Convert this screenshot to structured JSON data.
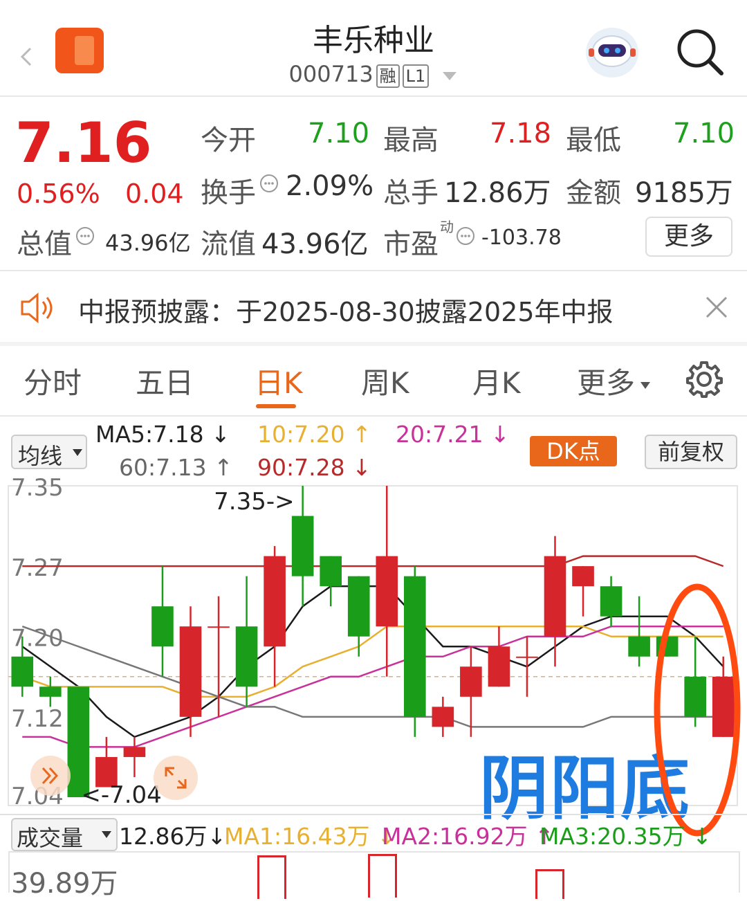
{
  "header": {
    "stock_name": "丰乐种业",
    "stock_code": "000713",
    "tag_margin": "融",
    "tag_level": "L1"
  },
  "quote": {
    "price": "7.16",
    "change_pct": "0.56%",
    "change_amt": "0.04",
    "open_label": "今开",
    "open_value": "7.10",
    "high_label": "最高",
    "high_value": "7.18",
    "low_label": "最低",
    "low_value": "7.10",
    "turnover_label": "换手",
    "turnover_value": "2.09%",
    "volume_label": "总手",
    "volume_value": "12.86万",
    "amount_label": "金额",
    "amount_value": "9185万",
    "mcap_label": "总值",
    "mcap_value": "43.96亿",
    "float_label": "流值",
    "float_value": "43.96亿",
    "pe_label": "市盈",
    "pe_super": "动",
    "pe_value": "-103.78",
    "more_button": "更多"
  },
  "notice": {
    "text": "中报预披露：于2025-08-30披露2025年中报"
  },
  "tabs": [
    {
      "label": "分时",
      "active": false
    },
    {
      "label": "五日",
      "active": false
    },
    {
      "label": "日K",
      "active": true
    },
    {
      "label": "周K",
      "active": false
    },
    {
      "label": "月K",
      "active": false
    },
    {
      "label": "更多",
      "active": false
    }
  ],
  "ma_bar": {
    "selector": "均线",
    "ma5": "MA5:7.18",
    "ma10": "10:7.20",
    "ma20": "20:7.21",
    "ma60": "60:7.13",
    "ma90": "90:7.28",
    "dk_button": "DK点",
    "adjust_button": "前复权"
  },
  "volume_bar": {
    "selector": "成交量",
    "vol": "12.86万",
    "ma1": "MA1:16.43万",
    "ma2": "MA2:16.92万",
    "ma3": "MA3:20.35万",
    "axis_top": "39.89万"
  },
  "annotation": {
    "text": "阴阳底"
  },
  "colors": {
    "up": "#d6262b",
    "down": "#1a9e1a",
    "accent": "#e8671b",
    "ma5": "#1a1a1a",
    "ma10": "#e8b030",
    "ma20": "#c8309a",
    "ma60": "#777777",
    "ma90": "#b82a2a",
    "annotation_text": "#1e7be0",
    "annotation_circle": "#ff4a10"
  },
  "chart_data": {
    "type": "candlestick",
    "y_ticks": [
      "7.35",
      "7.27",
      "7.20",
      "7.12",
      "7.04"
    ],
    "ylim": [
      7.04,
      7.35
    ],
    "max_label": "7.35->",
    "min_label": "<-7.04",
    "ref_price": 7.16,
    "candles": [
      {
        "o": 7.18,
        "h": 7.2,
        "l": 7.14,
        "c": 7.15
      },
      {
        "o": 7.15,
        "h": 7.16,
        "l": 7.13,
        "c": 7.14
      },
      {
        "o": 7.15,
        "h": 7.15,
        "l": 7.04,
        "c": 7.04
      },
      {
        "o": 7.05,
        "h": 7.1,
        "l": 7.05,
        "c": 7.08
      },
      {
        "o": 7.08,
        "h": 7.1,
        "l": 7.06,
        "c": 7.09
      },
      {
        "o": 7.23,
        "h": 7.27,
        "l": 7.16,
        "c": 7.19
      },
      {
        "o": 7.12,
        "h": 7.23,
        "l": 7.1,
        "c": 7.21
      },
      {
        "o": 7.21,
        "h": 7.24,
        "l": 7.12,
        "c": 7.21
      },
      {
        "o": 7.21,
        "h": 7.26,
        "l": 7.13,
        "c": 7.15
      },
      {
        "o": 7.19,
        "h": 7.29,
        "l": 7.15,
        "c": 7.28
      },
      {
        "o": 7.32,
        "h": 7.35,
        "l": 7.23,
        "c": 7.26
      },
      {
        "o": 7.28,
        "h": 7.28,
        "l": 7.23,
        "c": 7.25
      },
      {
        "o": 7.26,
        "h": 7.26,
        "l": 7.18,
        "c": 7.2
      },
      {
        "o": 7.21,
        "h": 7.35,
        "l": 7.16,
        "c": 7.28
      },
      {
        "o": 7.26,
        "h": 7.27,
        "l": 7.1,
        "c": 7.12
      },
      {
        "o": 7.11,
        "h": 7.14,
        "l": 7.1,
        "c": 7.13
      },
      {
        "o": 7.14,
        "h": 7.19,
        "l": 7.1,
        "c": 7.17
      },
      {
        "o": 7.15,
        "h": 7.21,
        "l": 7.15,
        "c": 7.19
      },
      {
        "o": 7.18,
        "h": 7.2,
        "l": 7.14,
        "c": 7.18
      },
      {
        "o": 7.2,
        "h": 7.3,
        "l": 7.17,
        "c": 7.28
      },
      {
        "o": 7.25,
        "h": 7.27,
        "l": 7.22,
        "c": 7.27
      },
      {
        "o": 7.25,
        "h": 7.26,
        "l": 7.21,
        "c": 7.22
      },
      {
        "o": 7.2,
        "h": 7.24,
        "l": 7.17,
        "c": 7.18
      },
      {
        "o": 7.2,
        "h": 7.2,
        "l": 7.18,
        "c": 7.18
      },
      {
        "o": 7.16,
        "h": 7.2,
        "l": 7.11,
        "c": 7.12
      },
      {
        "o": 7.1,
        "h": 7.18,
        "l": 7.1,
        "c": 7.16
      }
    ],
    "ma_series": [
      {
        "name": "MA5",
        "values": [
          7.19,
          7.17,
          7.15,
          7.12,
          7.1,
          7.11,
          7.12,
          7.14,
          7.17,
          7.19,
          7.23,
          7.25,
          7.25,
          7.25,
          7.22,
          7.19,
          7.19,
          7.18,
          7.17,
          7.19,
          7.21,
          7.22,
          7.22,
          7.22,
          7.2,
          7.17
        ]
      },
      {
        "name": "MA10",
        "values": [
          7.16,
          7.15,
          7.15,
          7.15,
          7.15,
          7.15,
          7.14,
          7.14,
          7.14,
          7.15,
          7.17,
          7.18,
          7.19,
          7.21,
          7.21,
          7.21,
          7.21,
          7.21,
          7.21,
          7.21,
          7.21,
          7.2,
          7.2,
          7.2,
          7.2,
          7.2
        ]
      },
      {
        "name": "MA20",
        "values": [
          7.1,
          7.1,
          7.09,
          7.09,
          7.09,
          7.1,
          7.11,
          7.12,
          7.13,
          7.14,
          7.15,
          7.16,
          7.16,
          7.17,
          7.18,
          7.18,
          7.19,
          7.19,
          7.2,
          7.2,
          7.2,
          7.21,
          7.21,
          7.21,
          7.21,
          7.21
        ]
      },
      {
        "name": "MA60",
        "values": [
          7.21,
          7.2,
          7.19,
          7.18,
          7.17,
          7.16,
          7.15,
          7.14,
          7.13,
          7.13,
          7.12,
          7.12,
          7.12,
          7.12,
          7.12,
          7.12,
          7.11,
          7.11,
          7.11,
          7.11,
          7.11,
          7.12,
          7.12,
          7.12,
          7.12,
          7.12
        ]
      },
      {
        "name": "MA90",
        "values": [
          7.27,
          7.27,
          7.27,
          7.27,
          7.27,
          7.27,
          7.27,
          7.27,
          7.27,
          7.27,
          7.27,
          7.27,
          7.27,
          7.27,
          7.27,
          7.27,
          7.27,
          7.27,
          7.27,
          7.27,
          7.28,
          7.28,
          7.28,
          7.28,
          7.28,
          7.27
        ]
      }
    ]
  }
}
